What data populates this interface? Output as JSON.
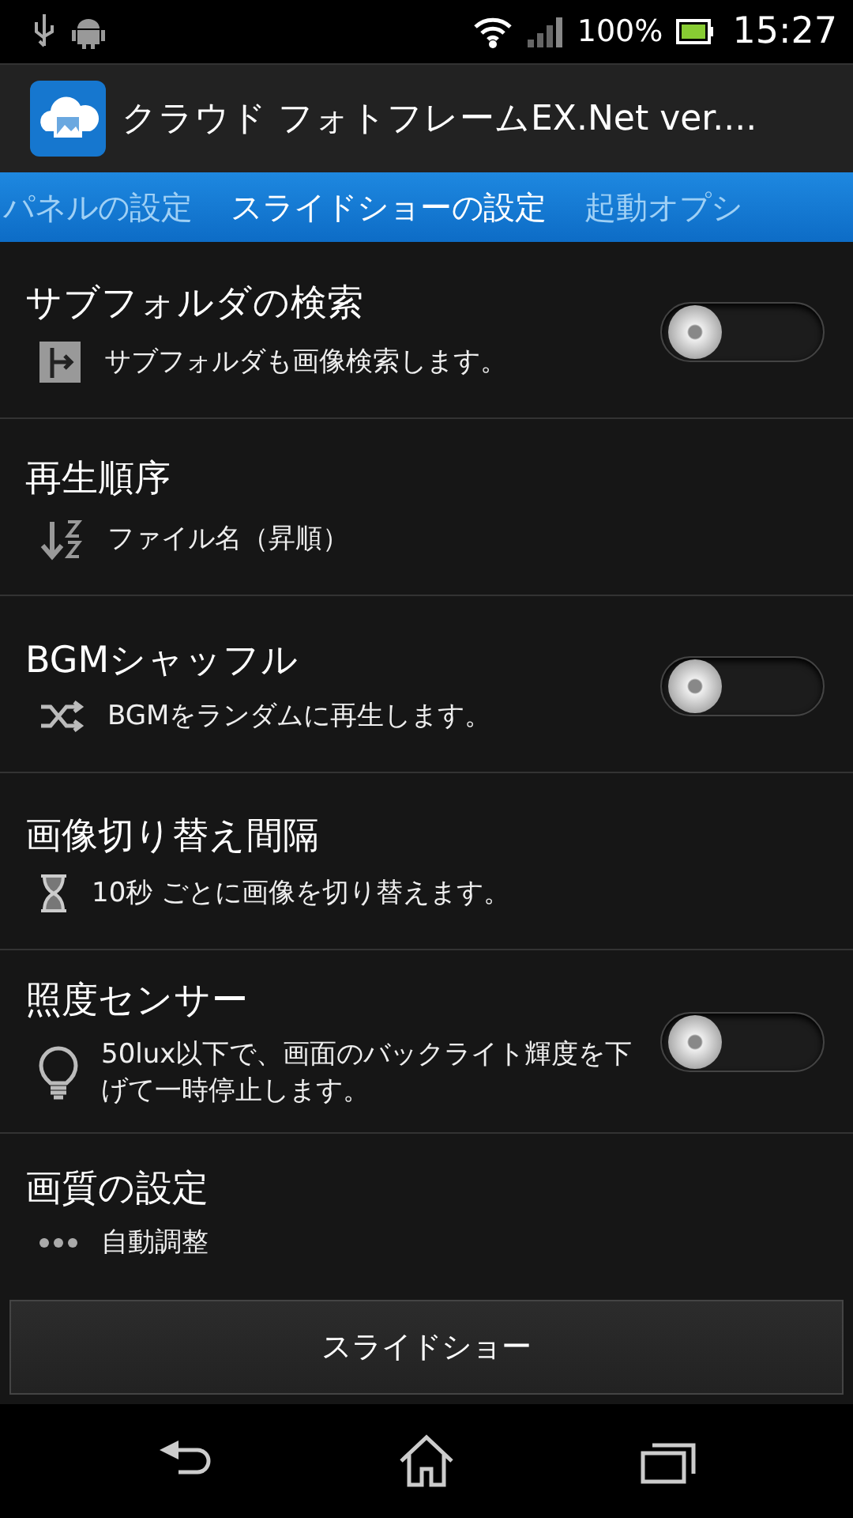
{
  "status_bar": {
    "battery": "100%",
    "time": "15:27"
  },
  "action_bar": {
    "title": "クラウド フォトフレームEX.Net  ver...."
  },
  "tabs": [
    {
      "label": "パネルの設定",
      "selected": false
    },
    {
      "label": "スライドショーの設定",
      "selected": true
    },
    {
      "label": "起動オプシ",
      "selected": false
    }
  ],
  "settings": [
    {
      "kind": "toggle",
      "title": "サブフォルダの検索",
      "summary": "サブフォルダも画像検索します。",
      "checked": false
    },
    {
      "kind": "value",
      "title": "再生順序",
      "summary": "ファイル名（昇順）"
    },
    {
      "kind": "toggle",
      "title": "BGMシャッフル",
      "summary": "BGMをランダムに再生します。",
      "checked": false
    },
    {
      "kind": "value",
      "title": "画像切り替え間隔",
      "summary": "10秒 ごとに画像を切り替えます。"
    },
    {
      "kind": "toggle",
      "title": "照度センサー",
      "summary": "50lux以下で、画面のバックライト輝度を下げて一時停止します。",
      "checked": false
    },
    {
      "kind": "value",
      "title": "画質の設定",
      "summary": "自動調整"
    }
  ],
  "button": {
    "label": "スライドショー"
  }
}
